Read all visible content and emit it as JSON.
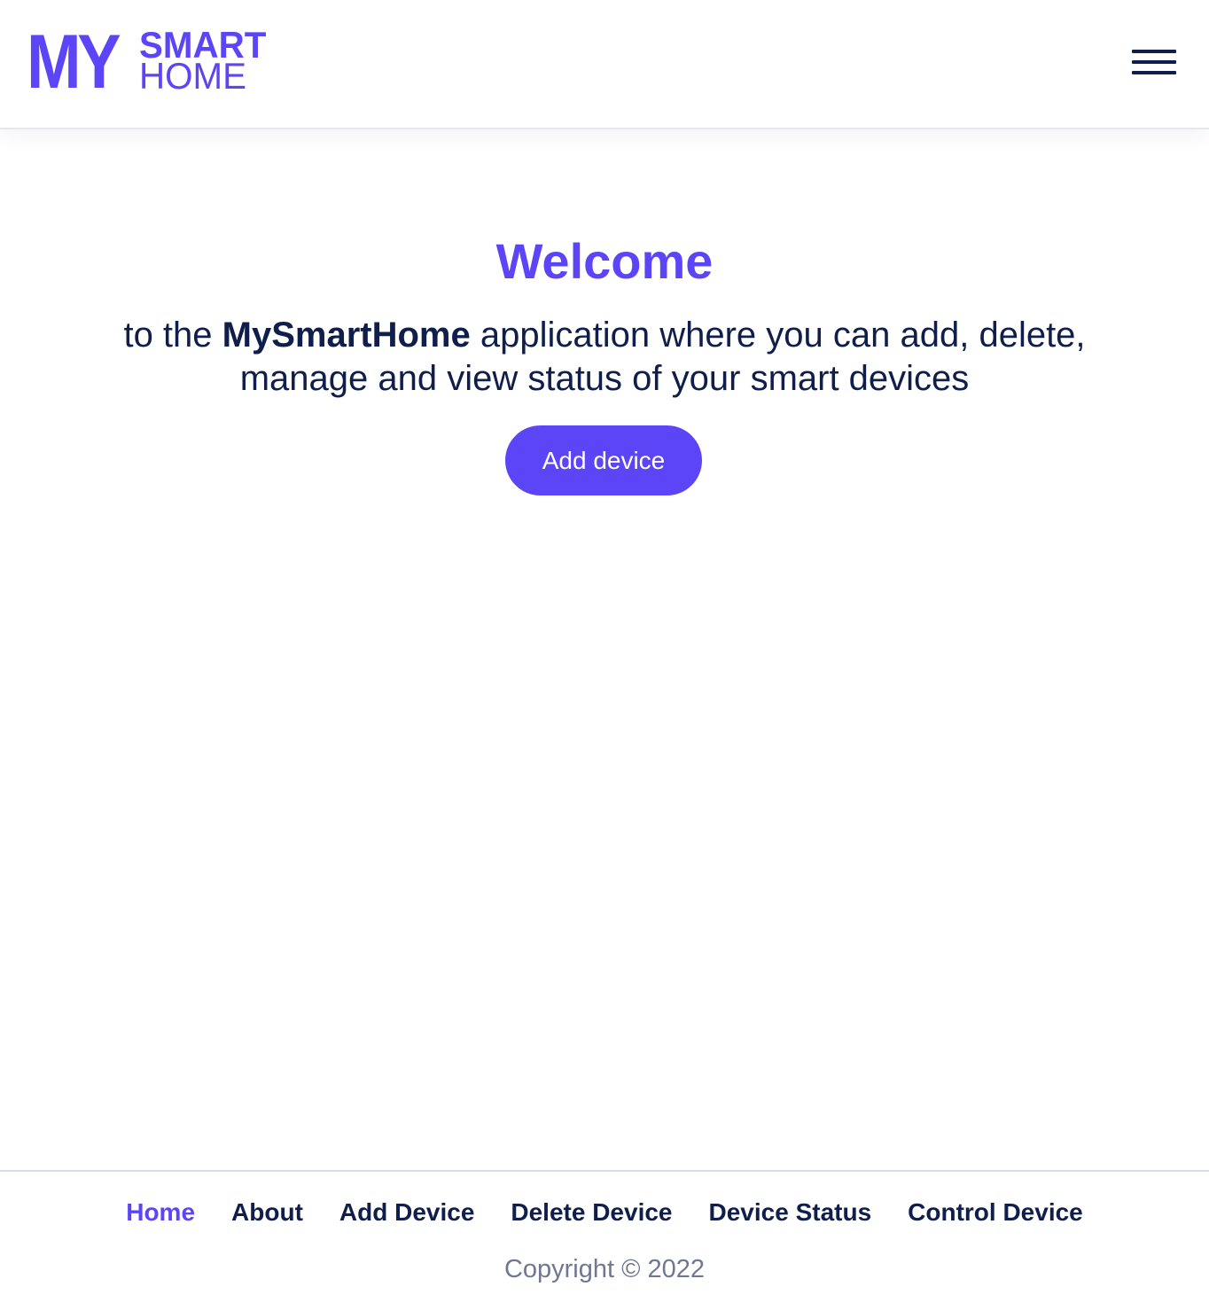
{
  "header": {
    "logo": {
      "my": "MY",
      "smart": "SMART",
      "home": "HOME"
    },
    "menu_icon": "hamburger-menu-icon"
  },
  "main": {
    "title": "Welcome",
    "intro_prefix": "to the ",
    "intro_brand": "MySmartHome",
    "intro_suffix": " application where you can add, delete, manage and view status of your smart devices",
    "add_button_label": "Add device"
  },
  "footer": {
    "nav": [
      {
        "label": "Home",
        "active": true
      },
      {
        "label": "About",
        "active": false
      },
      {
        "label": "Add Device",
        "active": false
      },
      {
        "label": "Delete Device",
        "active": false
      },
      {
        "label": "Device Status",
        "active": false
      },
      {
        "label": "Control Device",
        "active": false
      }
    ],
    "copyright": "Copyright © 2022"
  },
  "colors": {
    "brand": "#5b45f6",
    "text": "#0f1e4a",
    "muted": "#6f7890"
  }
}
